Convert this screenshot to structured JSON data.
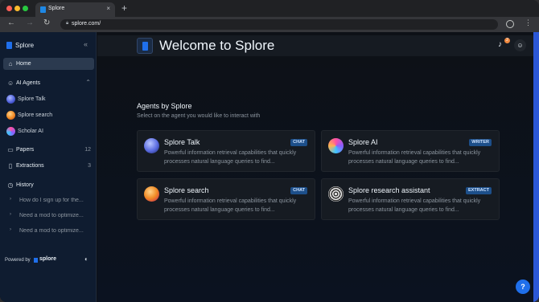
{
  "browser": {
    "tab_title": "Splore",
    "tab_close": "×",
    "new_tab": "+",
    "url": "splore.com/",
    "back": "←",
    "forward": "→",
    "reload": "↻",
    "menu": "⋮"
  },
  "sidebar": {
    "brand": "Splore",
    "home": "Home",
    "ai_agents": "AI Agents",
    "agents": [
      {
        "label": "Splore Talk",
        "icon": "globe-avatar"
      },
      {
        "label": "Splore search",
        "icon": "orange-orb-avatar"
      },
      {
        "label": "Scholar AI",
        "icon": "rainbow-avatar"
      }
    ],
    "papers": {
      "label": "Papers",
      "count": "12"
    },
    "extractions": {
      "label": "Extractions",
      "count": "3"
    },
    "history_title": "History",
    "history": [
      "How do I sign up for the...",
      "Need a mod to optimize...",
      "Need a mod to optimize..."
    ],
    "powered_by": "Powered by",
    "powered_brand": "splore"
  },
  "topbar": {
    "notification_count": "2"
  },
  "main": {
    "welcome": "Welcome to Splore",
    "section_title": "Agents by Splore",
    "section_sub": "Select on the agent you would like to interact with",
    "cards": [
      {
        "name": "Splore Talk",
        "badge": "CHAT",
        "desc": "Powerful information retrieval capabilities that quickly processes natural language queries to find..."
      },
      {
        "name": "Splore AI",
        "badge": "WRITER",
        "desc": "Powerful information retrieval capabilities that quickly processes natural language queries to find..."
      },
      {
        "name": "Splore search",
        "badge": "CHAT",
        "desc": "Powerful information retrieval capabilities that quickly processes natural language queries to find..."
      },
      {
        "name": "Splore research assistant",
        "badge": "EXTRACT",
        "desc": "Powerful information retrieval capabilities that quickly processes natural language queries to find..."
      }
    ]
  },
  "help": "?",
  "colors": {
    "accent": "#1f6feb",
    "sidebar_bg": "#0f1c30",
    "badge_bg": "#1d4f8a"
  }
}
